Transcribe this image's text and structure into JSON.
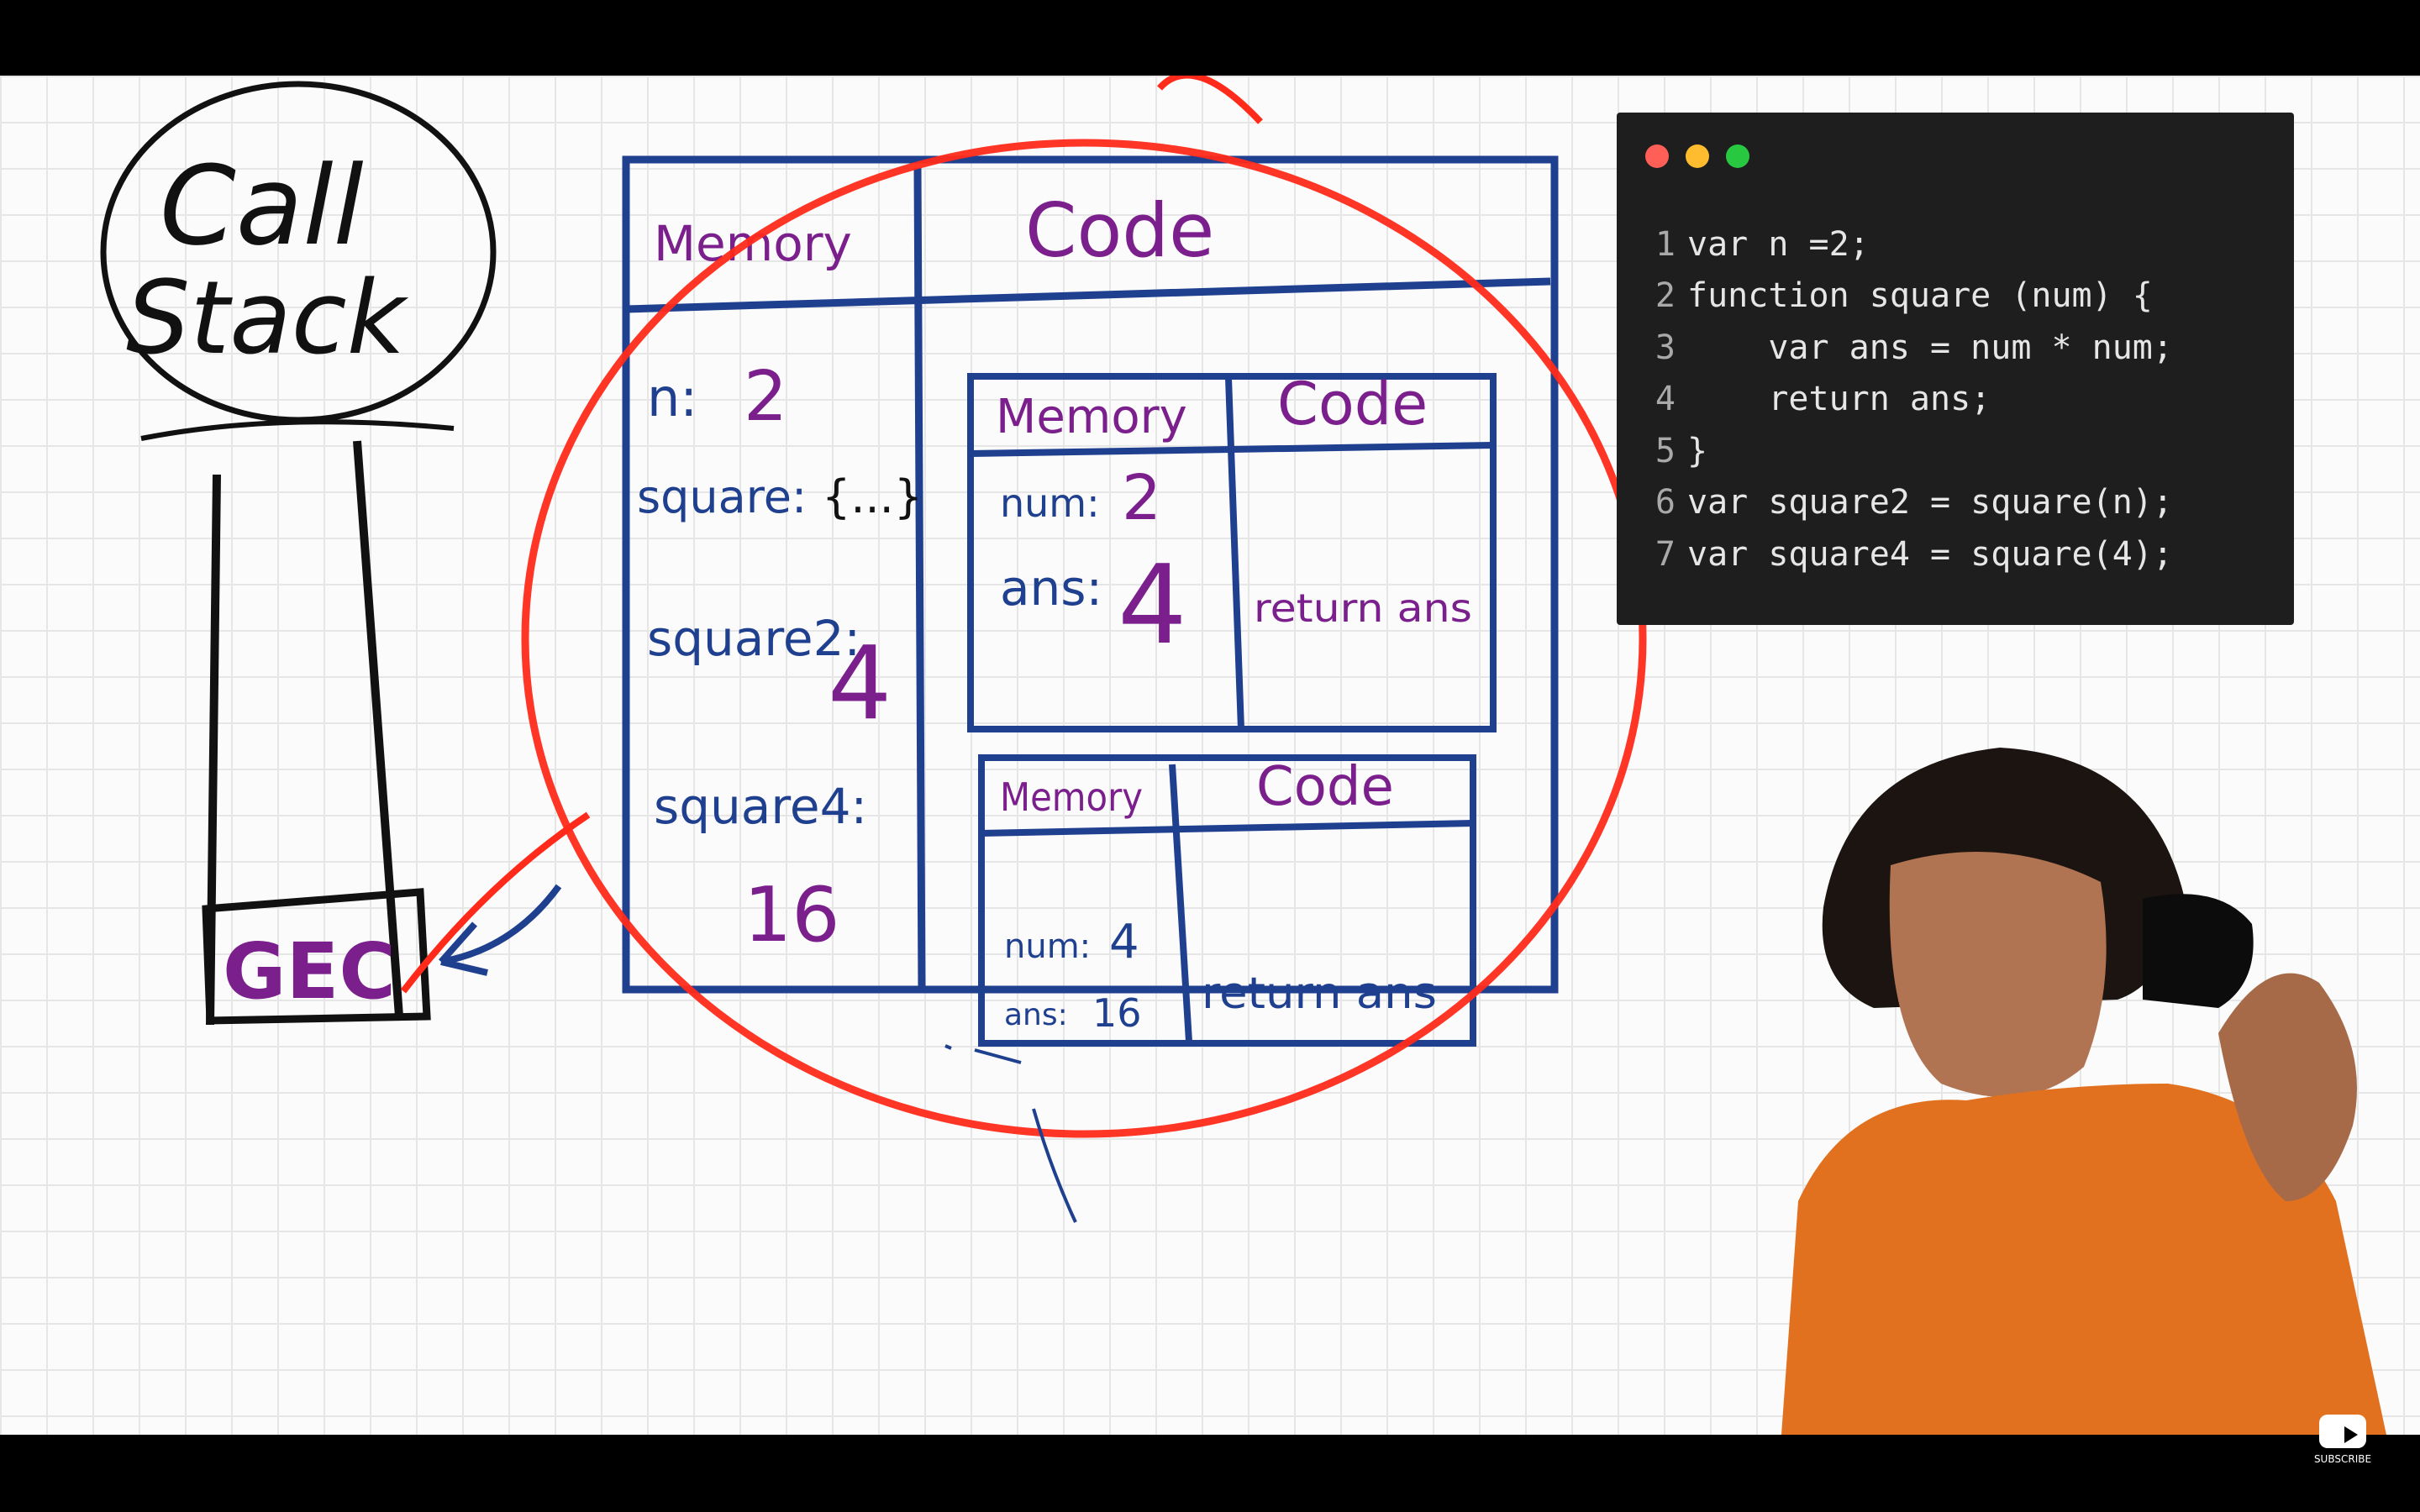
{
  "whiteboard": {
    "call_stack_label_line1": "Call",
    "call_stack_label_line2": "Stack",
    "gec_label": "GEC",
    "outer_context": {
      "memory_header": "Memory",
      "code_header": "Code",
      "entries": [
        {
          "name": "n:",
          "value": "2"
        },
        {
          "name": "square:",
          "value": "{...}"
        },
        {
          "name": "square2:",
          "value": "4"
        },
        {
          "name": "square4:",
          "value": "16"
        }
      ]
    },
    "inner_context_1": {
      "memory_header": "Memory",
      "code_header": "Code",
      "num_label": "num:",
      "num_value": "2",
      "ans_label": "ans:",
      "ans_value": "4",
      "code_text": "return ans"
    },
    "inner_context_2": {
      "memory_header": "Memory",
      "code_header": "Code",
      "num_label": "num:",
      "num_value": "4",
      "ans_label": "ans:",
      "ans_value": "16",
      "code_text": "return ans"
    }
  },
  "code_window": {
    "lines": [
      {
        "n": "1",
        "text": "var n =2;"
      },
      {
        "n": "2",
        "text": "function square (num) {"
      },
      {
        "n": "3",
        "text": "    var ans = num * num;"
      },
      {
        "n": "4",
        "text": "    return ans;"
      },
      {
        "n": "5",
        "text": "}"
      },
      {
        "n": "6",
        "text": "var square2 = square(n);"
      },
      {
        "n": "7",
        "text": "var square4 = square(4);"
      }
    ]
  },
  "subscribe_label": "SUBSCRIBE",
  "colors": {
    "ink_black": "#111111",
    "ink_blue": "#1f3f8f",
    "ink_purple": "#7a1f8c",
    "highlight_red": "#ff2a1a"
  }
}
